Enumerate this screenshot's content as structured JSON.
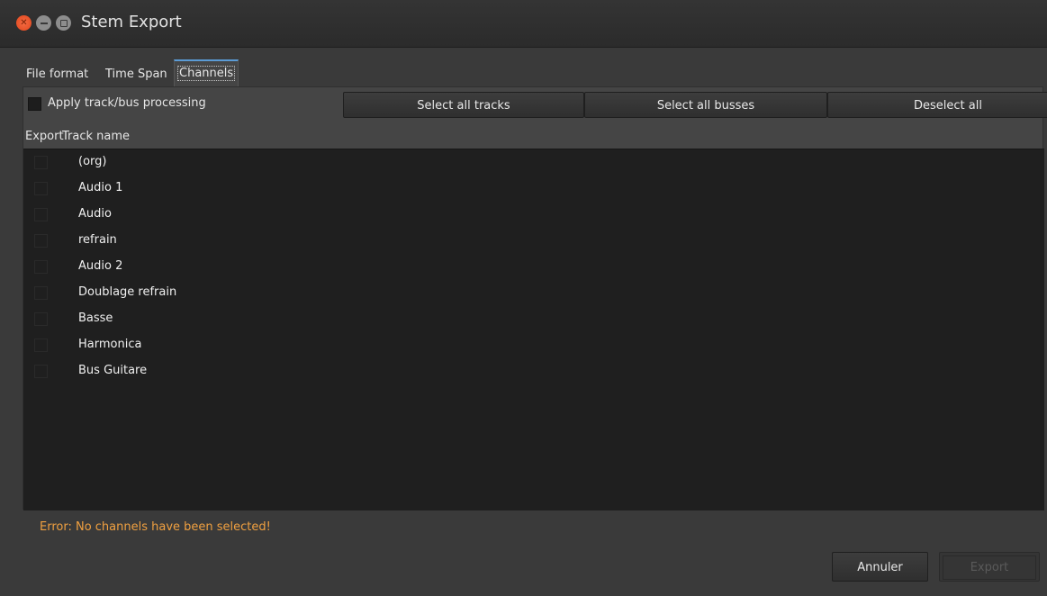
{
  "window": {
    "title": "Stem Export"
  },
  "tabs": [
    {
      "label": "File format"
    },
    {
      "label": "Time Span"
    },
    {
      "label": "Channels"
    }
  ],
  "options": {
    "apply_processing_label": "Apply track/bus processing",
    "apply_processing_checked": false,
    "select_all_tracks": "Select all tracks",
    "select_all_busses": "Select all busses",
    "deselect_all": "Deselect all"
  },
  "table": {
    "headers": {
      "export": "Export",
      "name": "Track name"
    },
    "rows": [
      {
        "name": "(org)",
        "checked": false
      },
      {
        "name": "Audio 1",
        "checked": false
      },
      {
        "name": "Audio",
        "checked": false
      },
      {
        "name": "refrain",
        "checked": false
      },
      {
        "name": "Audio 2",
        "checked": false
      },
      {
        "name": "Doublage refrain",
        "checked": false
      },
      {
        "name": "Basse",
        "checked": false
      },
      {
        "name": "Harmonica",
        "checked": false
      },
      {
        "name": "Bus Guitare",
        "checked": false
      }
    ]
  },
  "status": {
    "error": "Error: No channels have been selected!"
  },
  "footer": {
    "cancel": "Annuler",
    "export": "Export"
  },
  "colors": {
    "error": "#f0a040",
    "accent": "#5b9bd5",
    "close": "#e2461c"
  }
}
